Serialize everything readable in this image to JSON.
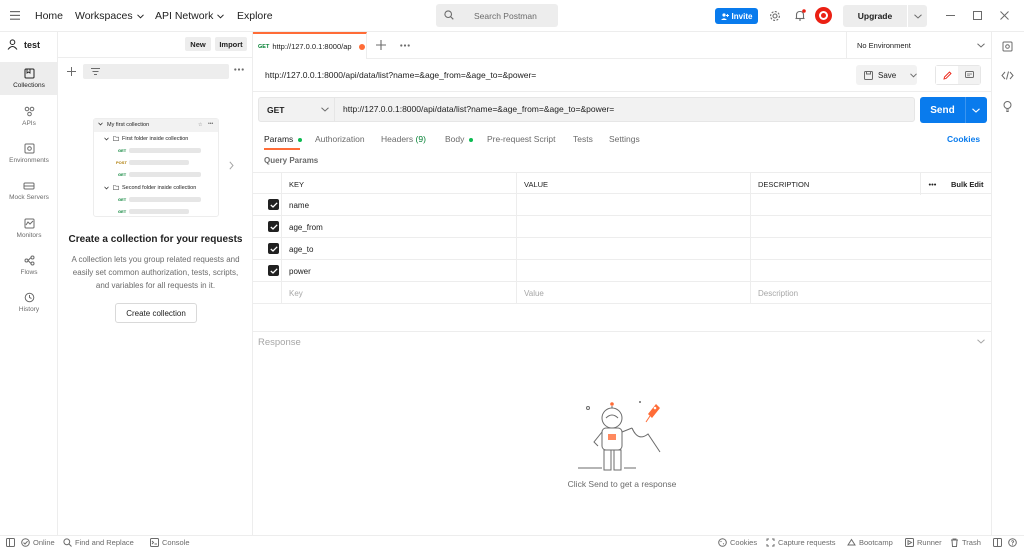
{
  "topbar": {
    "home": "Home",
    "workspaces": "Workspaces",
    "api_network": "API Network",
    "explore": "Explore",
    "search_placeholder": "Search Postman",
    "invite": "Invite",
    "upgrade": "Upgrade"
  },
  "sidebar": {
    "workspace_name": "test",
    "new_label": "New",
    "import_label": "Import",
    "rail": [
      {
        "label": "Collections",
        "icon": "collections-icon"
      },
      {
        "label": "APIs",
        "icon": "apis-icon"
      },
      {
        "label": "Environments",
        "icon": "environments-icon"
      },
      {
        "label": "Mock Servers",
        "icon": "mock-servers-icon"
      },
      {
        "label": "Monitors",
        "icon": "monitors-icon"
      },
      {
        "label": "Flows",
        "icon": "flows-icon"
      },
      {
        "label": "History",
        "icon": "history-icon"
      }
    ],
    "illustration": {
      "collection": "My first collection",
      "folder1": "First folder inside collection",
      "folder2": "Second folder inside collection",
      "get": "GET",
      "post": "POST"
    },
    "empty_title": "Create a collection for your requests",
    "empty_desc": "A collection lets you group related requests and easily set common authorization, tests, scripts, and variables for all requests in it.",
    "create_collection": "Create collection"
  },
  "tabs": {
    "active_method": "GET",
    "active_label": "http://127.0.0.1:8000/ap",
    "environment": "No Environment"
  },
  "request": {
    "title": "http://127.0.0.1:8000/api/data/list?name=&age_from=&age_to=&power=",
    "save": "Save",
    "method": "GET",
    "url": "http://127.0.0.1:8000/api/data/list?name=&age_from=&age_to=&power=",
    "send": "Send",
    "tabs": [
      "Params",
      "Authorization",
      "Headers",
      "Body",
      "Pre-request Script",
      "Tests",
      "Settings"
    ],
    "headers_count": "(9)",
    "cookies": "Cookies",
    "query_params_title": "Query Params"
  },
  "params_table": {
    "headers": {
      "key": "KEY",
      "value": "VALUE",
      "description": "DESCRIPTION",
      "more": "•••",
      "bulk_edit": "Bulk Edit"
    },
    "rows": [
      {
        "key": "name",
        "value": "",
        "description": ""
      },
      {
        "key": "age_from",
        "value": "",
        "description": ""
      },
      {
        "key": "age_to",
        "value": "",
        "description": ""
      },
      {
        "key": "power",
        "value": "",
        "description": ""
      }
    ],
    "placeholder": {
      "key": "Key",
      "value": "Value",
      "description": "Description"
    }
  },
  "response": {
    "title": "Response",
    "empty": "Click Send to get a response"
  },
  "statusbar": {
    "online": "Online",
    "find_replace": "Find and Replace",
    "console": "Console",
    "cookies": "Cookies",
    "capture": "Capture requests",
    "bootcamp": "Bootcamp",
    "runner": "Runner",
    "trash": "Trash"
  },
  "colors": {
    "accent": "#097bed",
    "brand": "#ff6c37",
    "get_method": "#007f31"
  }
}
